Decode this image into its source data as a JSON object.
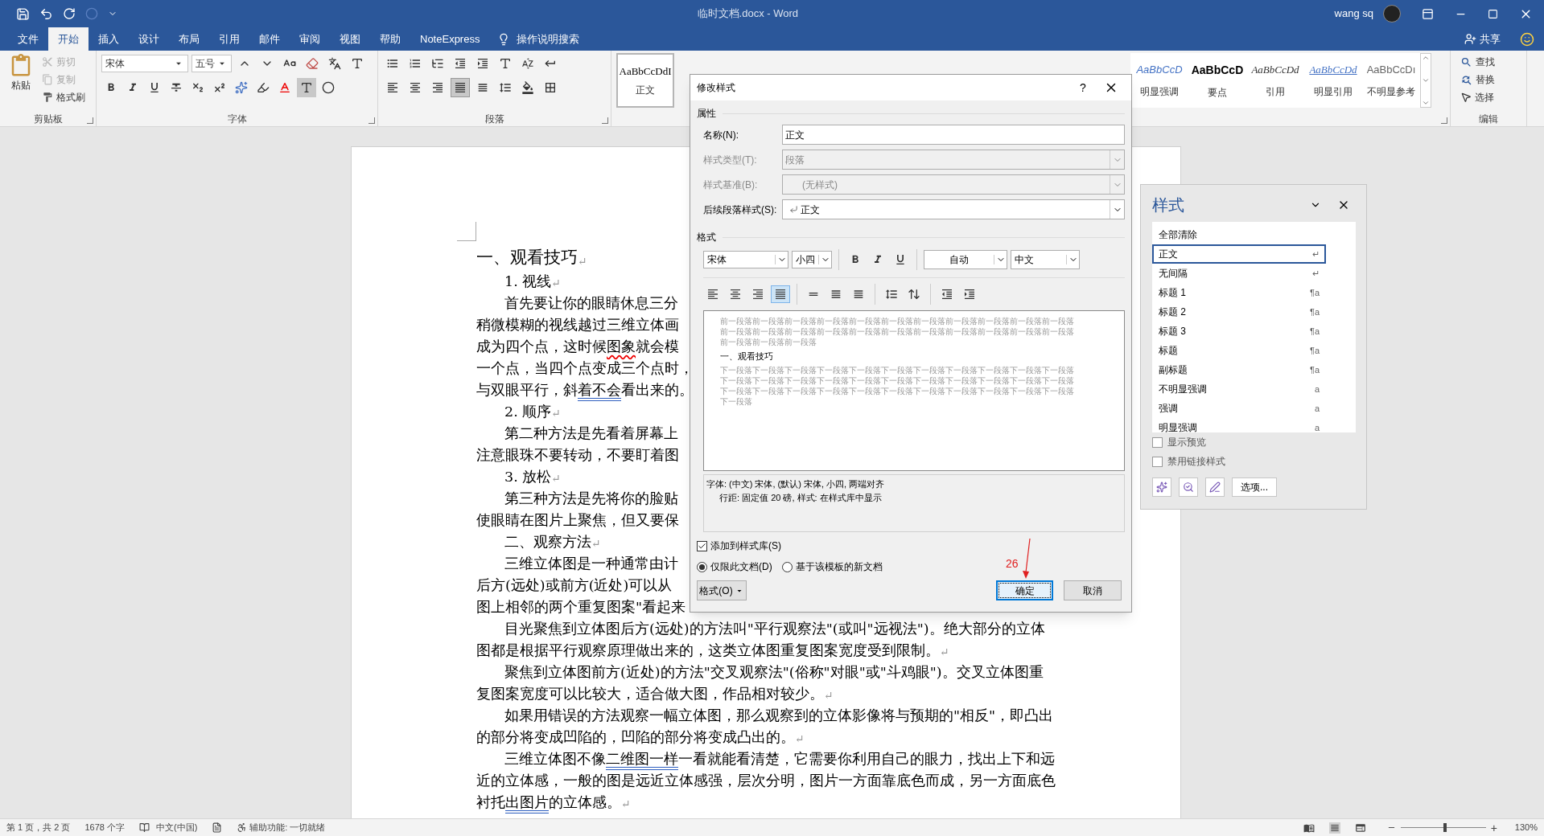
{
  "title_bar": {
    "title": "临时文档.docx  -  Word",
    "user": "wang sq"
  },
  "menu_tabs": [
    {
      "label": "文件",
      "selected": false
    },
    {
      "label": "开始",
      "selected": true
    },
    {
      "label": "插入",
      "selected": false
    },
    {
      "label": "设计",
      "selected": false
    },
    {
      "label": "布局",
      "selected": false
    },
    {
      "label": "引用",
      "selected": false
    },
    {
      "label": "邮件",
      "selected": false
    },
    {
      "label": "审阅",
      "selected": false
    },
    {
      "label": "视图",
      "selected": false
    },
    {
      "label": "帮助",
      "selected": false
    },
    {
      "label": "NoteExpress",
      "selected": false
    }
  ],
  "tell_me": "操作说明搜索",
  "share": "共享",
  "ribbon": {
    "clipboard": {
      "paste": "粘贴",
      "actions": [
        {
          "label": "剪切",
          "disabled": true
        },
        {
          "label": "复制",
          "disabled": true
        },
        {
          "label": "格式刷",
          "disabled": false
        }
      ],
      "label": "剪贴板"
    },
    "font": {
      "name": "宋体",
      "size": "五号",
      "label": "字体"
    },
    "paragraph": {
      "label": "段落"
    },
    "styles_gallery": [
      {
        "preview": "AaBbCcDdI",
        "name": "正文",
        "selected": true,
        "kind": "normal"
      },
      {
        "preview": "AaBbCcD",
        "name": "明显强调",
        "selected": false,
        "kind": "emphasis"
      },
      {
        "preview": "AaBbCcD",
        "name": "要点",
        "selected": false,
        "kind": "strong"
      },
      {
        "preview": "AaBbCcDd",
        "name": "引用",
        "selected": false,
        "kind": "quote"
      },
      {
        "preview": "AaBbCcDd",
        "name": "明显引用",
        "selected": false,
        "kind": "intense_quote"
      },
      {
        "preview": "AaBbCcDı",
        "name": "不明显参考",
        "selected": false,
        "kind": "reference"
      }
    ],
    "editing": {
      "find": "查找",
      "replace": "替换",
      "select": "选择",
      "label": "编辑"
    }
  },
  "document": {
    "lines": [
      {
        "kind": "heading",
        "parts": [
          "一、观看技巧"
        ],
        "end_mark": "↵"
      },
      {
        "kind": "indent",
        "parts": [
          "1. 视线"
        ],
        "end_mark": "↵"
      },
      {
        "kind": "indent",
        "parts": [
          "首先要让你的眼睛休息三分"
        ]
      },
      {
        "kind": "body",
        "parts": [
          "稍微模糊的视线越过三维立体画"
        ]
      },
      {
        "kind": "body",
        "parts": [
          "成为四个点，这时候",
          {
            "text": "图象",
            "kind": "spelling"
          },
          "就会模"
        ]
      },
      {
        "kind": "body",
        "parts": [
          "一个点，当四个点变成三个点时，"
        ]
      },
      {
        "kind": "body",
        "parts": [
          "与双眼平行，斜",
          {
            "text": "着不会",
            "kind": "grammar"
          },
          "看出来的。"
        ]
      },
      {
        "kind": "indent",
        "parts": [
          "2. 顺序"
        ],
        "end_mark": "↵"
      },
      {
        "kind": "indent",
        "parts": [
          "第二种方法是先看着屏幕上"
        ]
      },
      {
        "kind": "body",
        "parts": [
          "注意眼珠不要转动，不要盯着图"
        ]
      },
      {
        "kind": "indent",
        "parts": [
          "3. 放松"
        ],
        "end_mark": "↵"
      },
      {
        "kind": "indent",
        "parts": [
          "第三种方法是先将你的脸贴"
        ]
      },
      {
        "kind": "body",
        "parts": [
          "使眼睛在图片上聚焦，但又要保"
        ]
      },
      {
        "kind": "indent",
        "parts": [
          "二、观察方法"
        ],
        "end_mark": "↵"
      },
      {
        "kind": "indent",
        "parts": [
          "三维立体图是一种通常由计"
        ]
      },
      {
        "kind": "body",
        "parts": [
          "后方(远处)或前方(近处)可以从"
        ]
      },
      {
        "kind": "body",
        "parts": [
          "图上相邻的两个重复图案\"看起来"
        ]
      },
      {
        "kind": "indent",
        "parts": [
          "目光聚焦到立体图后方(远处)的方法叫\"平行观察法\"(或叫\"远视法\")。绝大部分的立体"
        ]
      },
      {
        "kind": "body",
        "parts": [
          "图都是根据平行观察原理做出来的，这类立体图重复图案宽度受到限制。"
        ],
        "end_mark": "↵"
      },
      {
        "kind": "indent",
        "parts": [
          "聚焦到立体图前方(近处)的方法\"交叉观察法\"(俗称\"对眼\"或\"斗鸡眼\")。交叉立体图重"
        ]
      },
      {
        "kind": "body",
        "parts": [
          "复图案宽度可以比较大，适合做大图，作品相对较少。"
        ],
        "end_mark": "↵"
      },
      {
        "kind": "indent",
        "parts": [
          "如果用错误的方法观察一幅立体图，那么观察到的立体影像将与预期的\"相反\"，即凸出"
        ]
      },
      {
        "kind": "body",
        "parts": [
          "的部分将变成凹陷的，凹陷的部分将变成凸出的。"
        ],
        "end_mark": "↵"
      },
      {
        "kind": "indent",
        "parts": [
          "三维立体图不像",
          {
            "text": "二维图一样",
            "kind": "grammar"
          },
          "一看就能看清楚，它需要你利用自己的眼力，找出上下和远"
        ]
      },
      {
        "kind": "body",
        "parts": [
          "近的立体感，一般的图是远近立体感强，层次分明，图片一方面靠底色而成，另一方面底色"
        ]
      },
      {
        "kind": "body",
        "parts": [
          "衬托",
          {
            "text": "出图片",
            "kind": "grammar"
          },
          "的立体感。"
        ],
        "end_mark": "↵"
      }
    ]
  },
  "dialog": {
    "title": "修改样式",
    "help": "?",
    "properties_label": "属性",
    "fields": [
      {
        "label": "名称(N):",
        "value": "正文",
        "kind": "text",
        "disabled": false
      },
      {
        "label": "样式类型(T):",
        "value": "段落",
        "kind": "select",
        "disabled": true
      },
      {
        "label": "样式基准(B):",
        "value": "(无样式)",
        "kind": "select",
        "disabled": true
      },
      {
        "label": "后续段落样式(S):",
        "value": "正文",
        "kind": "select_para",
        "disabled": false
      }
    ],
    "format_label": "格式",
    "font": "宋体",
    "size": "小四",
    "font_color_choice": "自动",
    "script": "中文",
    "alignments": [
      {
        "kind": "left",
        "selected": false
      },
      {
        "kind": "center",
        "selected": false
      },
      {
        "kind": "right",
        "selected": false
      },
      {
        "kind": "justify",
        "selected": true
      }
    ],
    "preview": {
      "before": "前一段落前一段落前一段落前一段落前一段落前一段落前一段落前一段落前一段落前一段落前一段落前一段落前一段落前一段落前一段落前一段落前一段落前一段落前一段落前一段落前一段落前一段落前一段落前一段落前一段落",
      "sample": "一、观看技巧",
      "after": "下一段落下一段落下一段落下一段落下一段落下一段落下一段落下一段落下一段落下一段落下一段落下一段落下一段落下一段落下一段落下一段落下一段落下一段落下一段落下一段落下一段落下一段落下一段落下一段落下一段落下一段落下一段落下一段落下一段落下一段落下一段落下一段落下一段落下一段落"
    },
    "description": [
      "字体: (中文) 宋体, (默认) 宋体, 小四, 两端对齐",
      "行距: 固定值 20 磅, 样式: 在样式库中显示"
    ],
    "add_to_gallery": {
      "label": "添加到样式库(S)",
      "checked": true
    },
    "scope": [
      {
        "label": "仅限此文档(D)",
        "selected": true
      },
      {
        "label": "基于该模板的新文档",
        "selected": false
      }
    ],
    "format_button": "格式(O)",
    "ok": "确定",
    "cancel": "取消",
    "annotation": "26"
  },
  "styles_pane": {
    "title": "样式",
    "items": [
      {
        "name": "全部清除",
        "selected": false
      },
      {
        "name": "正文",
        "marker": "↵",
        "selected": true
      },
      {
        "name": "无间隔",
        "marker": "↵",
        "selected": false
      },
      {
        "name": "标题 1",
        "marker": "¶a",
        "selected": false
      },
      {
        "name": "标题 2",
        "marker": "¶a",
        "selected": false
      },
      {
        "name": "标题 3",
        "marker": "¶a",
        "selected": false
      },
      {
        "name": "标题",
        "marker": "¶a",
        "selected": false
      },
      {
        "name": "副标题",
        "marker": "¶a",
        "selected": false
      },
      {
        "name": "不明显强调",
        "marker": "a",
        "selected": false
      },
      {
        "name": "强调",
        "marker": "a",
        "selected": false
      },
      {
        "name": "明显强调",
        "marker": "a",
        "selected": false
      }
    ],
    "options": [
      {
        "label": "显示预览",
        "checked": false
      },
      {
        "label": "禁用链接样式",
        "checked": false
      }
    ],
    "options_button": "选项..."
  },
  "status_bar": {
    "page": "第 1 页，共 2 页",
    "words": "1678 个字",
    "language": "中文(中国)",
    "accessibility": "辅助功能: 一切就绪",
    "zoom_in": "+",
    "zoom": "130%",
    "zoom_level": {
      "level": 0.52
    }
  }
}
